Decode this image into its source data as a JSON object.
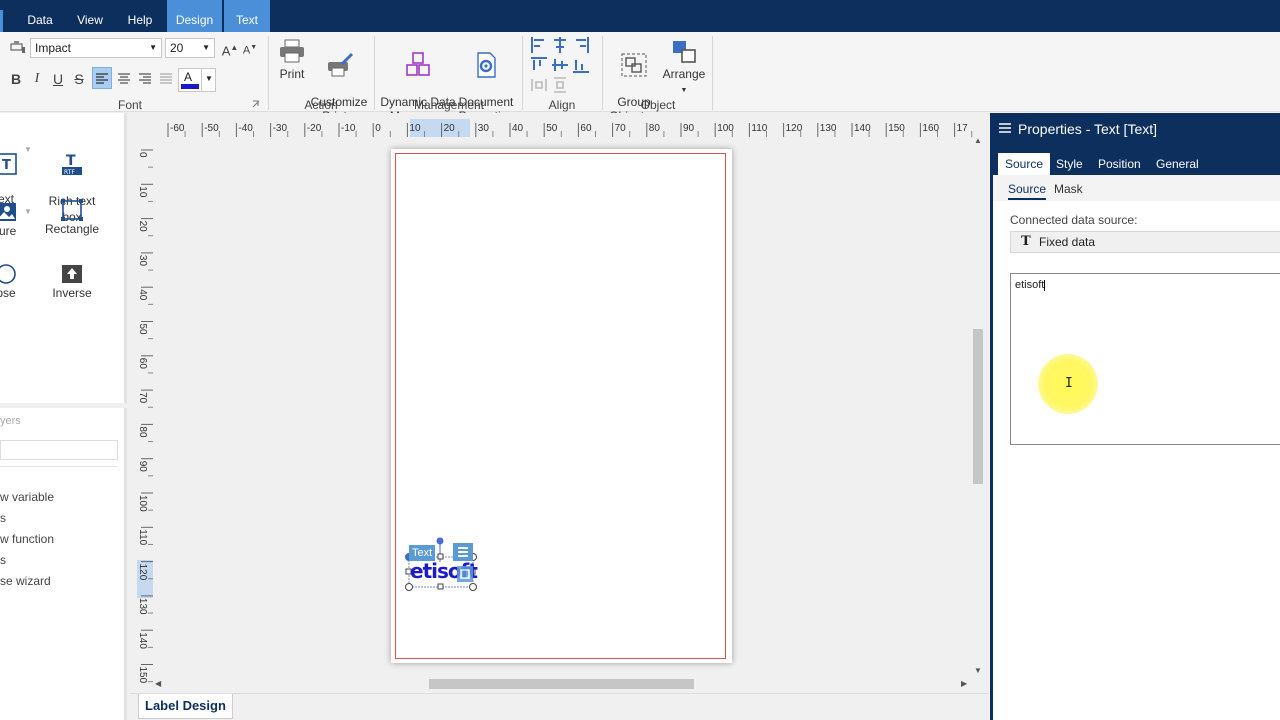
{
  "menu": {
    "items": [
      {
        "label": "Data"
      },
      {
        "label": "View"
      },
      {
        "label": "Help"
      },
      {
        "label": "Design"
      },
      {
        "label": "Text"
      }
    ]
  },
  "ribbon": {
    "font": {
      "family": "Impact",
      "size": "20",
      "group_label": "Font",
      "color_letter": "A",
      "text_color": "#1a1acc"
    },
    "action": {
      "print": "Print",
      "customize_print": "Customize\nPrint",
      "group_label": "Action"
    },
    "management": {
      "dynamic_data_manager": "Dynamic Data\nManager",
      "document_properties": "Document\nProperties",
      "group_label": "Management"
    },
    "align": {
      "group_label": "Align"
    },
    "object": {
      "group_objects": "Group\nObjects",
      "arrange": "Arrange",
      "group_label": "Object"
    }
  },
  "toolbox": {
    "tools": [
      {
        "label": "ext\nox"
      },
      {
        "label": "Rich text\nbox",
        "badge": "RTF"
      },
      {
        "label": "ture"
      },
      {
        "label": "Rectangle"
      },
      {
        "label": "pse"
      },
      {
        "label": "Inverse"
      }
    ]
  },
  "layers": {
    "header": "yers",
    "items": [
      {
        "label": "w variable"
      },
      {
        "label": "s"
      },
      {
        "label": "w function"
      },
      {
        "label": "s"
      },
      {
        "label": "se wizard"
      }
    ]
  },
  "ruler": {
    "h_labels": [
      "-60",
      "-50",
      "-40",
      "-30",
      "-20",
      "-10",
      "0",
      "10",
      "20",
      "30",
      "40",
      "50",
      "60",
      "70",
      "80",
      "90",
      "100",
      "110",
      "120",
      "130",
      "140",
      "150",
      "160",
      "17"
    ],
    "v_labels": [
      "0",
      "10",
      "20",
      "30",
      "40",
      "50",
      "60",
      "70",
      "80",
      "90",
      "100",
      "110",
      "120",
      "130",
      "140",
      "150"
    ]
  },
  "canvas": {
    "selected_object_tag": "Text",
    "object_text": "etisoft"
  },
  "bottom": {
    "tab_label": "Label Design"
  },
  "properties": {
    "title": "Properties - Text [Text]",
    "tabs": [
      {
        "label": "Source"
      },
      {
        "label": "Style"
      },
      {
        "label": "Position"
      },
      {
        "label": "General"
      }
    ],
    "subtabs": [
      {
        "label": "Source"
      },
      {
        "label": "Mask"
      }
    ],
    "connected_label": "Connected data source:",
    "data_source": "Fixed data",
    "data_source_icon": "T",
    "text_value": "etisoft"
  },
  "colors": {
    "menubar": "#0c2f5e",
    "context_tab": "#4b8fd9",
    "accent": "#0c2f5e",
    "margin_line": "#d9534f"
  }
}
